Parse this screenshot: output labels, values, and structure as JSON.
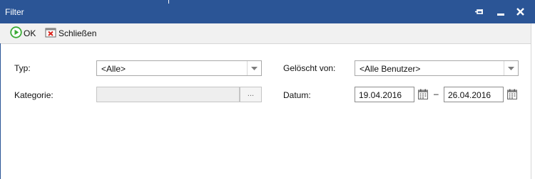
{
  "window": {
    "title": "Filter"
  },
  "titlebar_buttons": {
    "pin": "pin-icon",
    "minimize": "minimize-icon",
    "close": "close-icon"
  },
  "toolbar": {
    "ok_label": "OK",
    "close_label": "Schließen"
  },
  "form": {
    "typ": {
      "label": "Typ:",
      "value": "<Alle>"
    },
    "kategorie": {
      "label": "Kategorie:",
      "value": "",
      "button_label": "..."
    },
    "geloescht_von": {
      "label": "Gelöscht von:",
      "value": "<Alle Benutzer>"
    },
    "datum": {
      "label": "Datum:",
      "from": "19.04.2016",
      "separator": "–",
      "to": "26.04.2016"
    }
  },
  "colors": {
    "titlebar": "#2b5596",
    "toolbar": "#f1f1f1",
    "ok_green": "#3aaa35",
    "close_red": "#d9241c"
  }
}
